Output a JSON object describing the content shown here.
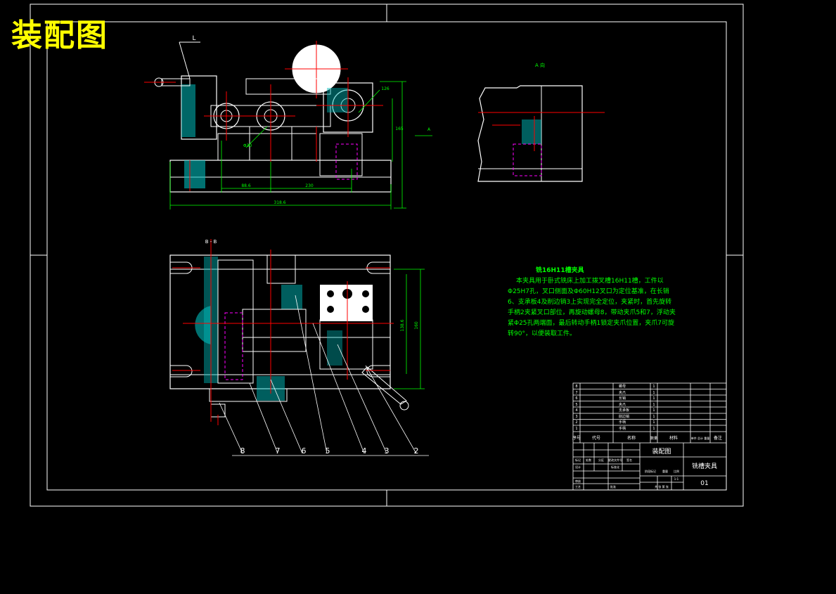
{
  "drawing": {
    "title": "装配图",
    "section_label": "B - B",
    "view_label_left": "L",
    "view_a_label": "A 向",
    "arrow_a": "A",
    "dims": {
      "overall_width": "318.6",
      "span_left": "88.6",
      "span_right": "230",
      "height_main": "165",
      "height_top": "126",
      "bore_label": "Φ30",
      "plan_left": "138.6",
      "plan_height": "160"
    },
    "balloons": [
      "8",
      "7",
      "6",
      "5",
      "4",
      "3",
      "2"
    ]
  },
  "note": {
    "title": "铣16H11槽夹具",
    "body": "本夹具用于卧式铣床上加工拨叉槽16H11槽，工件以Φ25H7孔，叉口侧面及Φ60H12叉口为定位基准，在长销6、支承板4及削边销3上实现完全定位，夹紧时，首先旋转手柄2夹紧叉口部位，再旋动螺母8，带动夹爪5和7，浮动夹紧Φ25孔两端面，最后转动手柄1锁定夹爪位置，夹爪7可旋转90°，以便装取工件。"
  },
  "title_block": {
    "drawing_name": "装配图",
    "part_name": "铣槽夹具",
    "drawing_no": "01",
    "scale_text": "1:1",
    "hdr_no": "序号",
    "hdr_code": "代号",
    "hdr_name": "名称",
    "hdr_qty": "数量",
    "hdr_material": "材料",
    "hdr_weight": "单件 总计 重量",
    "hdr_remark": "备注",
    "rows": [
      {
        "no": "8",
        "name": "螺母",
        "qty": "1"
      },
      {
        "no": "7",
        "name": "夹爪",
        "qty": "1"
      },
      {
        "no": "6",
        "name": "长销",
        "qty": "1"
      },
      {
        "no": "5",
        "name": "夹爪",
        "qty": "1"
      },
      {
        "no": "4",
        "name": "支承板",
        "qty": "1"
      },
      {
        "no": "3",
        "name": "削边销",
        "qty": "1"
      },
      {
        "no": "2",
        "name": "手柄",
        "qty": "1"
      },
      {
        "no": "1",
        "name": "手柄",
        "qty": "1"
      }
    ],
    "r_mark": "标记",
    "r_qty": "处数",
    "r_zone": "分区",
    "r_file": "更改文件号",
    "r_sign": "签名",
    "r_date": "年月日",
    "r_design": "设计",
    "r_std": "标准化",
    "r_check": "审核",
    "r_process": "工艺",
    "r_approve": "批准",
    "r_stage": "阶段标记",
    "r_weight": "重量",
    "r_ratio": "比例",
    "r_sheets": "共 张 第 张"
  }
}
